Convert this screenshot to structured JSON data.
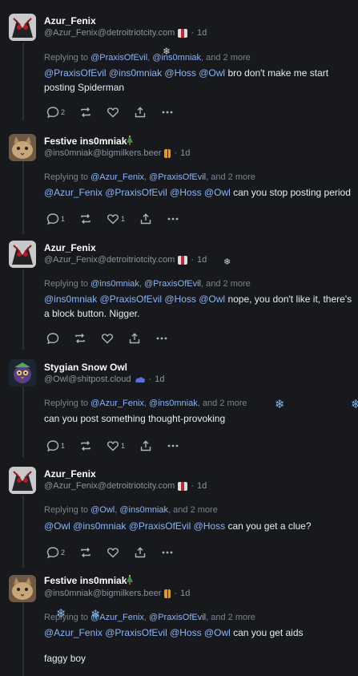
{
  "posts": [
    {
      "name": "Azur_Fenix",
      "handle": "@Azur_Fenix@detroitriotcity.com",
      "time": "1d",
      "reply_prefix": "Replying to",
      "reply_m1": "@PraxisOfEvil",
      "reply_m2": "@ins0mniak",
      "reply_more": ", and 2 more",
      "line1_mentions": "@PraxisOfEvil @ins0mniak @Hoss @Owl",
      "line1_text": " bro don't make me start",
      "line2_text": "posting Spiderman",
      "reply_count": "2",
      "boost_count": "",
      "like_count": ""
    },
    {
      "name": "Festive ins0mniak",
      "handle": "@ins0mniak@bigmilkers.beer",
      "time": "1d",
      "reply_prefix": "Replying to",
      "reply_m1": "@Azur_Fenix",
      "reply_m2": "@PraxisOfEvil",
      "reply_more": ", and 2 more",
      "line1_mentions": "@Azur_Fenix @PraxisOfEvil @Hoss @Owl",
      "line1_text": " can you stop posting period",
      "reply_count": "1",
      "boost_count": "",
      "like_count": "1"
    },
    {
      "name": "Azur_Fenix",
      "handle": "@Azur_Fenix@detroitriotcity.com",
      "time": "1d",
      "reply_prefix": "Replying to",
      "reply_m1": "@ins0mniak",
      "reply_m2": "@PraxisOfEvil",
      "reply_more": ", and 2 more",
      "line1_mentions": "@ins0mniak @PraxisOfEvil @Hoss @Owl",
      "line1_text": " nope, you don't like it, there's",
      "line2_text": "a block button. Nigger.",
      "reply_count": "",
      "boost_count": "",
      "like_count": ""
    },
    {
      "name": "Stygian Snow Owl",
      "handle": "@Owl@shitpost.cloud",
      "time": "1d",
      "reply_prefix": "Replying to",
      "reply_m1": "@Azur_Fenix",
      "reply_m2": "@ins0mniak",
      "reply_more": ", and 2 more",
      "line1_text": "can you post something thought-provoking",
      "reply_count": "1",
      "boost_count": "",
      "like_count": "1"
    },
    {
      "name": "Azur_Fenix",
      "handle": "@Azur_Fenix@detroitriotcity.com",
      "time": "1d",
      "reply_prefix": "Replying to",
      "reply_m1": "@Owl",
      "reply_m2": "@ins0mniak",
      "reply_more": ", and 2 more",
      "line1_mentions": "@Owl @ins0mniak @PraxisOfEvil @Hoss",
      "line1_text": " can you get a clue?",
      "reply_count": "2",
      "boost_count": "",
      "like_count": ""
    },
    {
      "name": "Festive ins0mniak",
      "handle": "@ins0mniak@bigmilkers.beer",
      "time": "1d",
      "reply_prefix": "Replying to",
      "reply_m1": "@Azur_Fenix",
      "reply_m2": "@PraxisOfEvil",
      "reply_more": ", and 2 more",
      "line1_mentions": "@Azur_Fenix @PraxisOfEvil @Hoss @Owl",
      "line1_text": " can you get aids",
      "line3_text": "faggy boy"
    }
  ],
  "separator_dot": "·",
  "icons": [
    "reply-icon",
    "boost-icon",
    "like-icon",
    "share-icon",
    "more-icon",
    "snowflake-icon",
    "christmas-tree-icon"
  ],
  "colors": {
    "background": "#17191d",
    "mention": "#8ab4f8",
    "muted": "#8b949e",
    "text": "#e6edf3"
  }
}
